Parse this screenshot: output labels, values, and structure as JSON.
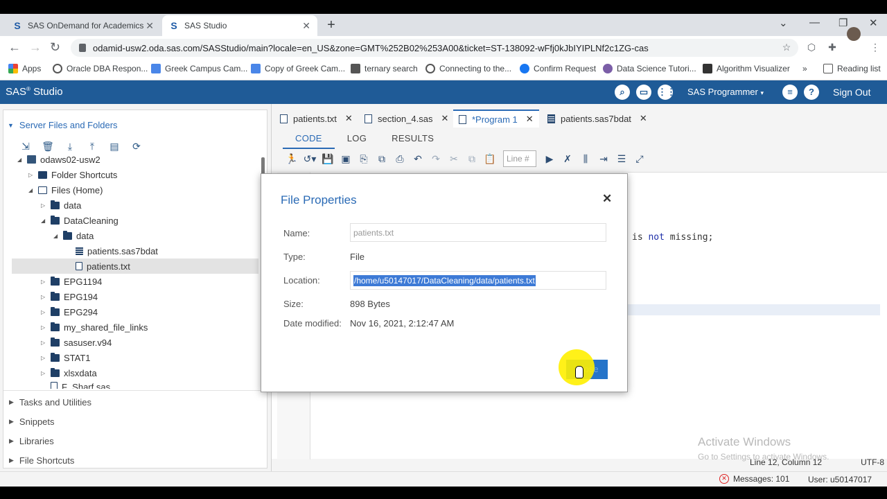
{
  "browser": {
    "tabs": [
      {
        "title": "SAS OnDemand for Academics",
        "active": false
      },
      {
        "title": "SAS Studio",
        "active": true
      }
    ],
    "url": "odamid-usw2.oda.sas.com/SASStudio/main?locale=en_US&zone=GMT%252B02%253A00&ticket=ST-138092-wFfj0kJbIYIPLNf2c1ZG-cas",
    "bookmarks": [
      "Apps",
      "Oracle DBA Respon...",
      "Greek Campus Cam...",
      "Copy of Greek Cam...",
      "ternary search",
      "Connecting to the...",
      "Confirm Request",
      "Data Science Tutori...",
      "Algorithm Visualizer",
      "Reading list"
    ]
  },
  "header": {
    "brand": "SAS",
    "brand_sup": "®",
    "brand_suffix": " Studio",
    "role": "SAS Programmer",
    "sign_out": "Sign Out",
    "brand_color": "#1f5b97"
  },
  "nav": {
    "server_files": "Server Files and Folders",
    "tree": {
      "server": "odaws02-usw2",
      "folder_shortcuts": "Folder Shortcuts",
      "files_home": "Files (Home)",
      "data": "data",
      "datacleaning": "DataCleaning",
      "dc_data": "data",
      "patients_sas": "patients.sas7bdat",
      "patients_txt": "patients.txt",
      "epg1194": "EPG1194",
      "epg194": "EPG194",
      "epg294": "EPG294",
      "my_shared": "my_shared_file_links",
      "sasuser": "sasuser.v94",
      "stat1": "STAT1",
      "xlsxdata": "xlsxdata",
      "partial": "F_Sharf.sas"
    },
    "tasks": "Tasks and Utilities",
    "snippets": "Snippets",
    "libraries": "Libraries",
    "file_shortcuts": "File Shortcuts"
  },
  "editor": {
    "tabs": [
      "patients.txt",
      "section_4.sas",
      "*Program 1",
      "patients.sas7bdat"
    ],
    "subtabs": [
      "CODE",
      "LOG",
      "RESULTS"
    ],
    "line_placeholder": "Line #",
    "code_pre": "is ",
    "code_kw": "not",
    "code_post": " missing;",
    "status": "Line 12, Column 12",
    "encoding": "UTF-8",
    "watermark_title": "Activate Windows",
    "watermark_sub": "Go to Settings to activate Windows."
  },
  "dialog": {
    "title": "File Properties",
    "name_label": "Name:",
    "name_value": "patients.txt",
    "type_label": "Type:",
    "type_value": "File",
    "location_label": "Location:",
    "location_value": "/home/u50147017/DataCleaning/data/patients.txt",
    "size_label": "Size:",
    "size_value": "898 Bytes",
    "modified_label": "Date modified:",
    "modified_value": "Nov 16, 2021, 2:12:47 AM",
    "close_label": "Close"
  },
  "status": {
    "messages": "Messages: 101",
    "user": "User: u50147017"
  }
}
